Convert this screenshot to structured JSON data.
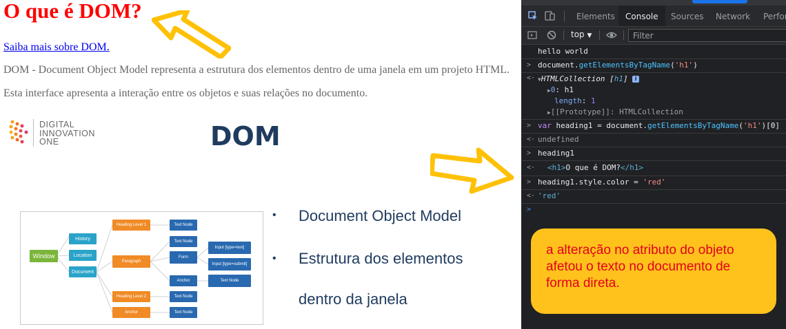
{
  "page": {
    "title": "O que é DOM?",
    "link": "Saiba mais sobre DOM.",
    "paragraph1": "DOM - Document Object Model representa a estrutura dos elementos dentro de uma janela em um projeto HTML.",
    "paragraph2": "Esta interface apresenta a interação entre os objetos e suas relações no documento."
  },
  "slide": {
    "logo_lines": [
      "DIGITAL",
      "INNOVATION",
      "ONE"
    ],
    "title": "DOM",
    "bullets": [
      "Document Object Model",
      "Estrutura dos elementos",
      "dentro da janela"
    ],
    "diagram_nodes": {
      "window": "Window",
      "history": "History",
      "location": "Location",
      "document": "Document",
      "heading1": "Heading Level 1",
      "paragraph": "Paragraph",
      "heading2": "Heading Level 2",
      "anchor1": "Anchor",
      "text1": "Text Node",
      "text2": "Text Node",
      "form": "Form",
      "anchor2": "Anchor",
      "text3": "Text Node",
      "text4": "Text Node",
      "input_text": "Input [type=text]",
      "input_submit": "Input [type=submit]",
      "text5": "Text Node"
    }
  },
  "devtools": {
    "tabs": [
      "Elements",
      "Console",
      "Sources",
      "Network",
      "Perfor"
    ],
    "active_tab": "Console",
    "context": "top",
    "filter_placeholder": "Filter",
    "console": {
      "l1": "hello world",
      "l2a": "document.",
      "l2b": "getElementsByTagName",
      "l2c": "(",
      "l2d": "'h1'",
      "l2e": ")",
      "l3a": "HTMLCollection [",
      "l3b": "h1",
      "l3c": "]",
      "l3badge": "i",
      "l4a": "0",
      "l4b": ": h1",
      "l5a": "length",
      "l5b": ": ",
      "l5c": "1",
      "l6": "[[Prototype]]: HTMLCollection",
      "l7a": "var",
      "l7b": " heading1 = document.",
      "l7c": "getElementsByTagName",
      "l7d": "(",
      "l7e": "'h1'",
      "l7f": ")[0]",
      "l8": "undefined",
      "l9": "heading1",
      "l10a": "<h1>",
      "l10b": "O que é DOM?",
      "l10c": "</h1>",
      "l11a": "heading1.style.color = ",
      "l11b": "'red'",
      "l12": "'red'"
    }
  },
  "note": "a alteração no atributo do objeto afetou o texto no documento de forma direta.",
  "colors": {
    "title_red": "#ff0000",
    "note_bg": "#ffc21c",
    "note_text": "#e3001b",
    "arrow": "#ffc107",
    "devtools_bg": "#202124",
    "slide_blue": "#1f3b5e"
  }
}
